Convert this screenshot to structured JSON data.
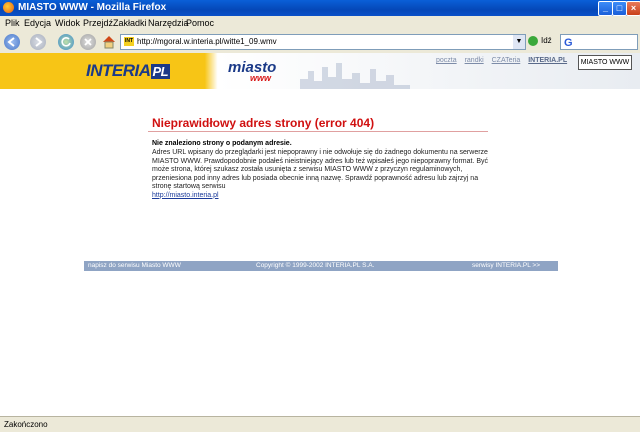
{
  "window": {
    "title": "MIASTO WWW - Mozilla Firefox",
    "controls": [
      "_",
      "□",
      "×"
    ]
  },
  "menu": [
    "Plik",
    "Edycja",
    "Widok",
    "Przejdź",
    "Zakładki",
    "Narzędzia",
    "Pomoc"
  ],
  "toolbar": {
    "url": "http://mgoral.w.interia.pl/witte1_09.wmv",
    "go_label": "Idź"
  },
  "site": {
    "logo_text": "INTERIA",
    "logo_pl": "PL",
    "miasto_logo": "miasto",
    "miasto_www": "www",
    "top_links": [
      "poczta",
      "randki",
      "CZATeria",
      "INTERIA.PL"
    ],
    "badge": "MIASTO WWW"
  },
  "error": {
    "title": "Nieprawidłowy adres strony (error 404)",
    "subtitle": "Nie znaleziono strony o podanym adresie.",
    "body": "Adres URL wpisany do przeglądarki jest niepoprawny i nie odwołuje się do żadnego dokumentu na serwerze MIASTO WWW. Prawdopodobnie podałeś nieistniejący adres lub też wpisałeś jego niepoprawny format. Być może strona, której szukasz została usunięta z serwisu MIASTO WWW z przyczyn regulaminowych, przeniesiona pod inny adres lub posiada obecnie inną nazwę. Sprawdź poprawność adresu lub zajrzyj na stronę startową serwisu",
    "link": "http://miasto.interia.pl"
  },
  "footer": {
    "left": "napisz do serwisu Miasto WWW",
    "center": "Copyright © 1999-2002 INTERIA.PL S.A.",
    "right": "serwisy INTERIA.PL >>"
  },
  "status": "Zakończono"
}
